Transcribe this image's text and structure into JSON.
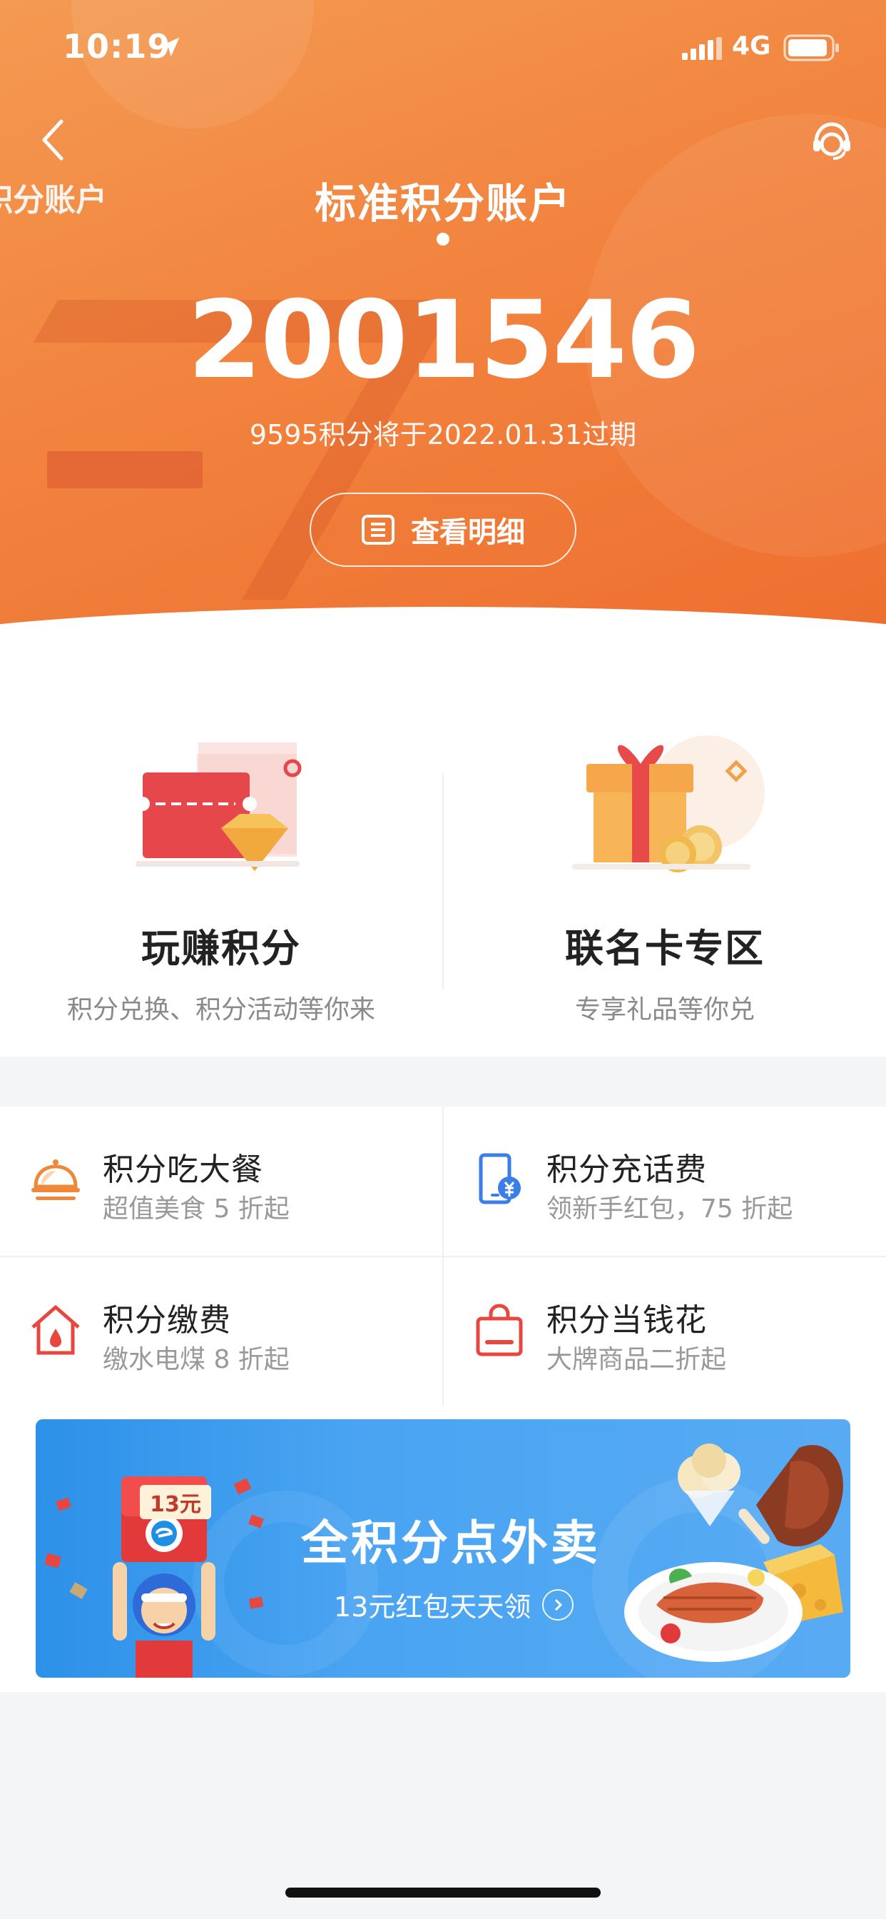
{
  "status_bar": {
    "time": "10:19",
    "network": "4G"
  },
  "header": {
    "prev_title": "积分账户",
    "title": "标准积分账户",
    "points": "2001546",
    "expire_notice": "9595积分将于2022.01.31过期",
    "detail_button": "查看明细"
  },
  "features": [
    {
      "title": "玩赚积分",
      "subtitle": "积分兑换、积分活动等你来"
    },
    {
      "title": "联名卡专区",
      "subtitle": "专享礼品等你兑"
    }
  ],
  "grid": [
    {
      "title": "积分吃大餐",
      "subtitle": "超值美食 5 折起",
      "icon": "dining-cloche-icon"
    },
    {
      "title": "积分充话费",
      "subtitle": "领新手红包，75 折起",
      "icon": "phone-recharge-icon"
    },
    {
      "title": "积分缴费",
      "subtitle": "缴水电煤 8 折起",
      "icon": "home-utility-icon"
    },
    {
      "title": "积分当钱花",
      "subtitle": "大牌商品二折起",
      "icon": "shopping-bag-icon"
    }
  ],
  "banner": {
    "title": "全积分点外卖",
    "subtitle": "13元红包天天领",
    "badge": "13元"
  },
  "colors": {
    "header_orange": "#f2843f",
    "banner_blue": "#4aa4f2",
    "icon_orange": "#f0883a",
    "icon_blue": "#3a7ee8",
    "icon_red": "#e8473f"
  }
}
